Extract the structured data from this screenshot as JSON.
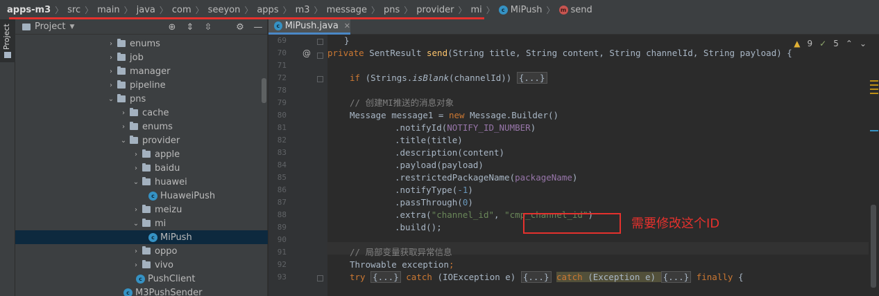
{
  "breadcrumb": {
    "items": [
      "apps-m3",
      "src",
      "main",
      "java",
      "com",
      "seeyon",
      "apps",
      "m3",
      "message",
      "pns",
      "provider",
      "mi",
      "MiPush",
      "send"
    ]
  },
  "tool_window": {
    "label": "Project"
  },
  "project_panel": {
    "title": "Project",
    "tree": [
      {
        "label": "enums",
        "type": "folder",
        "expanded": false,
        "indent": 0
      },
      {
        "label": "job",
        "type": "folder",
        "expanded": false,
        "indent": 0
      },
      {
        "label": "manager",
        "type": "folder",
        "expanded": false,
        "indent": 0
      },
      {
        "label": "pipeline",
        "type": "folder",
        "expanded": false,
        "indent": 0
      },
      {
        "label": "pns",
        "type": "folder",
        "expanded": true,
        "indent": 0
      },
      {
        "label": "cache",
        "type": "folder",
        "expanded": false,
        "indent": 1
      },
      {
        "label": "enums",
        "type": "folder",
        "expanded": false,
        "indent": 1
      },
      {
        "label": "provider",
        "type": "folder",
        "expanded": true,
        "indent": 1
      },
      {
        "label": "apple",
        "type": "folder",
        "expanded": false,
        "indent": 2
      },
      {
        "label": "baidu",
        "type": "folder",
        "expanded": false,
        "indent": 2
      },
      {
        "label": "huawei",
        "type": "folder",
        "expanded": true,
        "indent": 2
      },
      {
        "label": "HuaweiPush",
        "type": "class",
        "indent": 3
      },
      {
        "label": "meizu",
        "type": "folder",
        "expanded": false,
        "indent": 2
      },
      {
        "label": "mi",
        "type": "folder",
        "expanded": true,
        "indent": 2
      },
      {
        "label": "MiPush",
        "type": "class",
        "indent": 3,
        "selected": true
      },
      {
        "label": "oppo",
        "type": "folder",
        "expanded": false,
        "indent": 2
      },
      {
        "label": "vivo",
        "type": "folder",
        "expanded": false,
        "indent": 2
      },
      {
        "label": "PushClient",
        "type": "class",
        "indent": 2
      },
      {
        "label": "M3PushSender",
        "type": "class",
        "indent": 1
      }
    ]
  },
  "editor": {
    "tab_label": "MiPush.java",
    "inspections": {
      "warnings": "9",
      "weak_warnings": "5"
    },
    "lines": [
      {
        "n": "69"
      },
      {
        "n": "70"
      },
      {
        "n": "71"
      },
      {
        "n": "72"
      },
      {
        "n": "78"
      },
      {
        "n": "79"
      },
      {
        "n": "80"
      },
      {
        "n": "81"
      },
      {
        "n": "82"
      },
      {
        "n": "83"
      },
      {
        "n": "84"
      },
      {
        "n": "85"
      },
      {
        "n": "86"
      },
      {
        "n": "87"
      },
      {
        "n": "88"
      },
      {
        "n": "89"
      },
      {
        "n": "90"
      },
      {
        "n": "91"
      },
      {
        "n": "92"
      },
      {
        "n": "93"
      }
    ],
    "code": {
      "l69": "}",
      "l70_kw": "private",
      "l70_type": " SentResult ",
      "l70_fn": "send",
      "l70_rest": "(String title, String content, String channelId, String payload) {",
      "l72_kw": "if",
      "l72_a": " (Strings.",
      "l72_it": "isBlank",
      "l72_b": "(channelId)) ",
      "l72_fold": "{...}",
      "l79_cm": "// 创建MI推送的消息对象",
      "l80_a": "Message message1 = ",
      "l80_kw": "new",
      "l80_b": " Message.Builder()",
      "l81_a": ".notifyId(",
      "l81_c": "NOTIFY_ID_NUMBER",
      "l81_b": ")",
      "l82": ".title(title)",
      "l83": ".description(content)",
      "l84": ".payload(payload)",
      "l85_a": ".restrictedPackageName(",
      "l85_c": "packageName",
      "l85_b": ")",
      "l86_a": ".notifyType(",
      "l86_n": "-1",
      "l86_b": ")",
      "l87_a": ".passThrough(",
      "l87_n": "0",
      "l87_b": ")",
      "l88_a": ".extra(",
      "l88_s1": "\"channel_id\"",
      "l88_c": ", ",
      "l88_s2": "\"cmp_channel_id\"",
      "l88_b": ")",
      "l89": ".build();",
      "l91_cm": "// 局部变量获取异常信息",
      "l92_a": "Throwable exception",
      "l92_b": ";",
      "l93_kw1": "try",
      "l93_f1": "{...}",
      "l93_kw2": "catch",
      "l93_a": " (IOException e) ",
      "l93_f2": "{...}",
      "l93_kw3": "catch",
      "l93_b": " (Exception e) ",
      "l93_f3": "{...}",
      "l93_kw4": "finally",
      "l93_c": " {"
    }
  },
  "annotation_note": "需要修改这个ID",
  "colors": {
    "accent": "#4a88c7",
    "highlight_red": "#e5312d",
    "keyword": "#cc7832",
    "string": "#6a8759"
  }
}
